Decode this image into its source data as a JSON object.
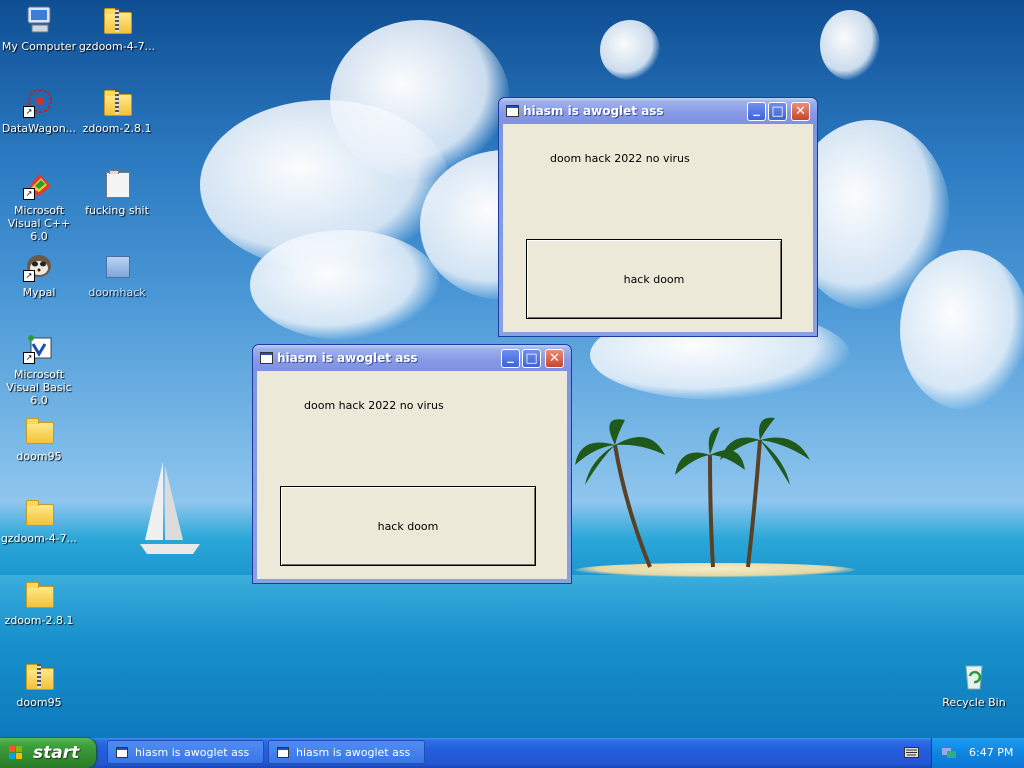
{
  "desktop": {
    "icons": [
      {
        "label": "My Computer"
      },
      {
        "label": "gzdoom-4-7..."
      },
      {
        "label": "DataWagon..."
      },
      {
        "label": "zdoom-2.8.1"
      },
      {
        "label": "Microsoft Visual C++ 6.0"
      },
      {
        "label": "fucking shit"
      },
      {
        "label": "Mypal"
      },
      {
        "label": "doomhack"
      },
      {
        "label": "Microsoft Visual Basic 6.0"
      },
      {
        "label": "doom95"
      },
      {
        "label": "gzdoom-4-7..."
      },
      {
        "label": "zdoom-2.8.1"
      },
      {
        "label": "doom95"
      },
      {
        "label": "Recycle Bin"
      }
    ]
  },
  "windows": [
    {
      "title": "hiasm is awoglet ass",
      "label": "doom hack 2022 no virus",
      "button": "hack doom"
    },
    {
      "title": "hiasm is awoglet ass",
      "label": "doom hack 2022 no virus",
      "button": "hack doom"
    }
  ],
  "window_controls": {
    "minimize": "_",
    "maximize": "□",
    "close": "✕"
  },
  "taskbar": {
    "start_label": "start",
    "buttons": [
      {
        "label": "hiasm is awoglet ass"
      },
      {
        "label": "hiasm is awoglet ass"
      }
    ],
    "clock": "6:47 PM"
  },
  "colors": {
    "taskbar_blue": "#245edb",
    "start_green": "#3c9c3a",
    "window_face": "#ece9d8",
    "titlebar_inactive": "#8699e6",
    "close_red": "#c8452c"
  }
}
